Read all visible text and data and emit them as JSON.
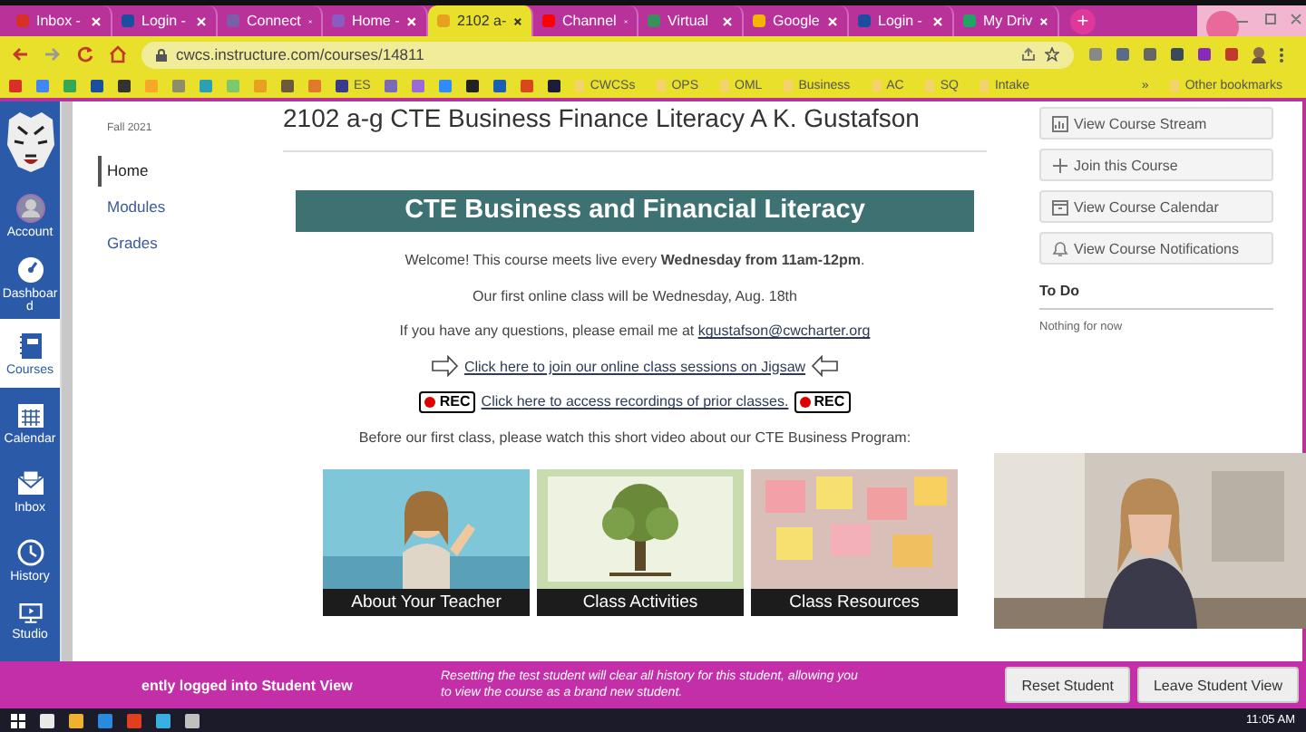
{
  "browser": {
    "tabs": [
      {
        "label": "Inbox -",
        "color": "#d93025",
        "selected": false
      },
      {
        "label": "Login -",
        "color": "#1a4fa0",
        "selected": false
      },
      {
        "label": "Connect",
        "color": "#7a5ea8",
        "selected": false
      },
      {
        "label": "Home -",
        "color": "#8a5cc2",
        "selected": false
      },
      {
        "label": "2102 a-",
        "color": "#e8a020",
        "selected": true
      },
      {
        "label": "Channel",
        "color": "#ff0000",
        "selected": false
      },
      {
        "label": "Virtual",
        "color": "#3a8f5a",
        "selected": false
      },
      {
        "label": "Google",
        "color": "#f4b400",
        "selected": false
      },
      {
        "label": "Login -",
        "color": "#1a4fa0",
        "selected": false
      },
      {
        "label": "My Driv",
        "color": "#1fa463",
        "selected": false
      }
    ],
    "new_tab": "+",
    "address": "cwcs.instructure.com/courses/14811",
    "bookmarks": [
      {
        "kind": "icon",
        "color": "#d93025"
      },
      {
        "kind": "icon",
        "color": "#4285f4"
      },
      {
        "kind": "icon",
        "color": "#34a853"
      },
      {
        "kind": "icon",
        "color": "#1a4fa0"
      },
      {
        "kind": "icon",
        "color": "#333333"
      },
      {
        "kind": "icon",
        "color": "#f9a825"
      },
      {
        "kind": "icon",
        "color": "#8d8d6a"
      },
      {
        "kind": "icon",
        "color": "#2aa0b8"
      },
      {
        "kind": "icon",
        "color": "#7cc86a"
      },
      {
        "kind": "icon",
        "color": "#e8a020"
      },
      {
        "kind": "icon",
        "color": "#6b5b3a"
      },
      {
        "kind": "icon",
        "color": "#e07a2a"
      },
      {
        "kind": "site",
        "label": "ES",
        "color": "#3a3a8a"
      },
      {
        "kind": "icon",
        "color": "#7a6ab8"
      },
      {
        "kind": "icon",
        "color": "#9a6ad8"
      },
      {
        "kind": "icon",
        "color": "#2d8cff"
      },
      {
        "kind": "icon",
        "color": "#222222"
      },
      {
        "kind": "icon",
        "color": "#1a5fb4"
      },
      {
        "kind": "icon",
        "color": "#d9481c"
      },
      {
        "kind": "icon",
        "color": "#1c1c3c"
      },
      {
        "kind": "folder",
        "label": "CWCSs"
      },
      {
        "kind": "folder",
        "label": "OPS"
      },
      {
        "kind": "folder",
        "label": "OML"
      },
      {
        "kind": "folder",
        "label": "Business"
      },
      {
        "kind": "folder",
        "label": "AC"
      },
      {
        "kind": "folder",
        "label": "SQ"
      },
      {
        "kind": "folder",
        "label": "Intake"
      },
      {
        "kind": "more",
        "label": "»"
      },
      {
        "kind": "folder",
        "label": "Other bookmarks"
      }
    ]
  },
  "global_nav": [
    {
      "label": "Account",
      "selected": false
    },
    {
      "label": "Dashboard",
      "selected": false
    },
    {
      "label": "Courses",
      "selected": true
    },
    {
      "label": "Calendar",
      "selected": false
    },
    {
      "label": "Inbox",
      "selected": false
    },
    {
      "label": "History",
      "selected": false
    },
    {
      "label": "Studio",
      "selected": false
    }
  ],
  "course_nav": {
    "term": "Fall 2021",
    "items": [
      {
        "label": "Home",
        "selected": true
      },
      {
        "label": "Modules",
        "selected": false
      },
      {
        "label": "Grades",
        "selected": false
      }
    ]
  },
  "course_title": "2102 a-g CTE Business Finance Literacy A K. Gustafson",
  "banner": "CTE Business and Financial Literacy",
  "content": [
    {
      "kind": "text",
      "text": "Welcome!  This course meets live every **Wednesday from 11am-12pm**."
    },
    {
      "kind": "text",
      "text": "Our first online class will be Wednesday, Aug. 18th"
    },
    {
      "kind": "text_link",
      "text": "If you have any questions, please email me at",
      "link": "kgustafson@cwcharter.org"
    },
    {
      "kind": "arrow_link",
      "link": "Click here to join our online class sessions on Jigsaw"
    },
    {
      "kind": "rec_link",
      "link": "Click here to access recordings of prior classes.",
      "badges": [
        "REC",
        "REC"
      ]
    },
    {
      "kind": "text",
      "text": "Before our first class, please watch this short video about our CTE Business Program:"
    }
  ],
  "cards": [
    {
      "label": "About Your Teacher"
    },
    {
      "label": "Class Activities"
    },
    {
      "label": "Class Resources"
    }
  ],
  "sidebar": {
    "buttons": [
      {
        "label": "View Course Stream"
      },
      {
        "label": "Join this Course"
      },
      {
        "label": "View Course Calendar"
      },
      {
        "label": "View Course Notifications"
      }
    ],
    "todo_title": "To Do",
    "todo_empty": "Nothing for now"
  },
  "student_view": {
    "message": "ently logged into Student View",
    "note": "Resetting the test student will clear all history for this student, allowing you to view the course as a brand new student.",
    "buttons": [
      "Reset Student",
      "Leave Student View"
    ]
  },
  "taskbar": {
    "time": "11:05 AM"
  }
}
